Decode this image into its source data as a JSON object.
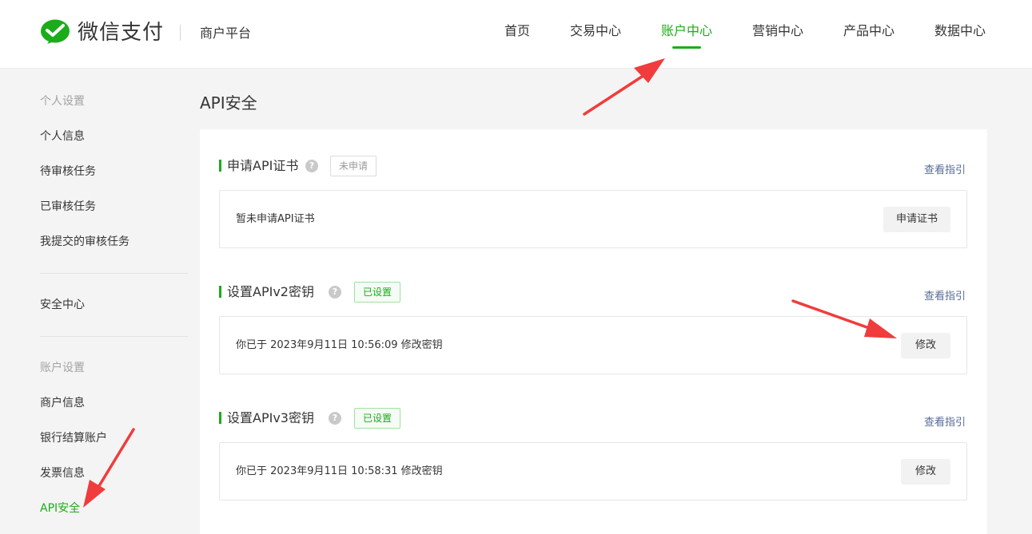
{
  "header": {
    "brand": "微信支付",
    "platform": "商户平台",
    "nav": [
      {
        "label": "首页",
        "active": false
      },
      {
        "label": "交易中心",
        "active": false
      },
      {
        "label": "账户中心",
        "active": true
      },
      {
        "label": "营销中心",
        "active": false
      },
      {
        "label": "产品中心",
        "active": false
      },
      {
        "label": "数据中心",
        "active": false
      }
    ]
  },
  "sidebar": {
    "group1": "个人设置",
    "items1": [
      "个人信息",
      "待审核任务",
      "已审核任务",
      "我提交的审核任务"
    ],
    "item_security": "安全中心",
    "group2": "账户设置",
    "items2": [
      "商户信息",
      "银行结算账户",
      "发票信息",
      "API安全"
    ],
    "active_item": "API安全"
  },
  "main": {
    "title": "API安全",
    "sections": [
      {
        "title": "申请API证书",
        "status": "未申请",
        "guide": "查看指引",
        "text": "暂未申请API证书",
        "button": "申请证书"
      },
      {
        "title": "设置APIv2密钥",
        "status": "已设置",
        "guide": "查看指引",
        "text": "你已于 2023年9月11日 10:56:09 修改密钥",
        "button": "修改"
      },
      {
        "title": "设置APIv3密钥",
        "status": "已设置",
        "guide": "查看指引",
        "text": "你已于 2023年9月11日 10:58:31 修改密钥",
        "button": "修改"
      }
    ],
    "help_glyph": "?"
  },
  "colors": {
    "accent": "#1aad19",
    "link": "#576b95",
    "annotation_arrow": "#f03c3c"
  }
}
